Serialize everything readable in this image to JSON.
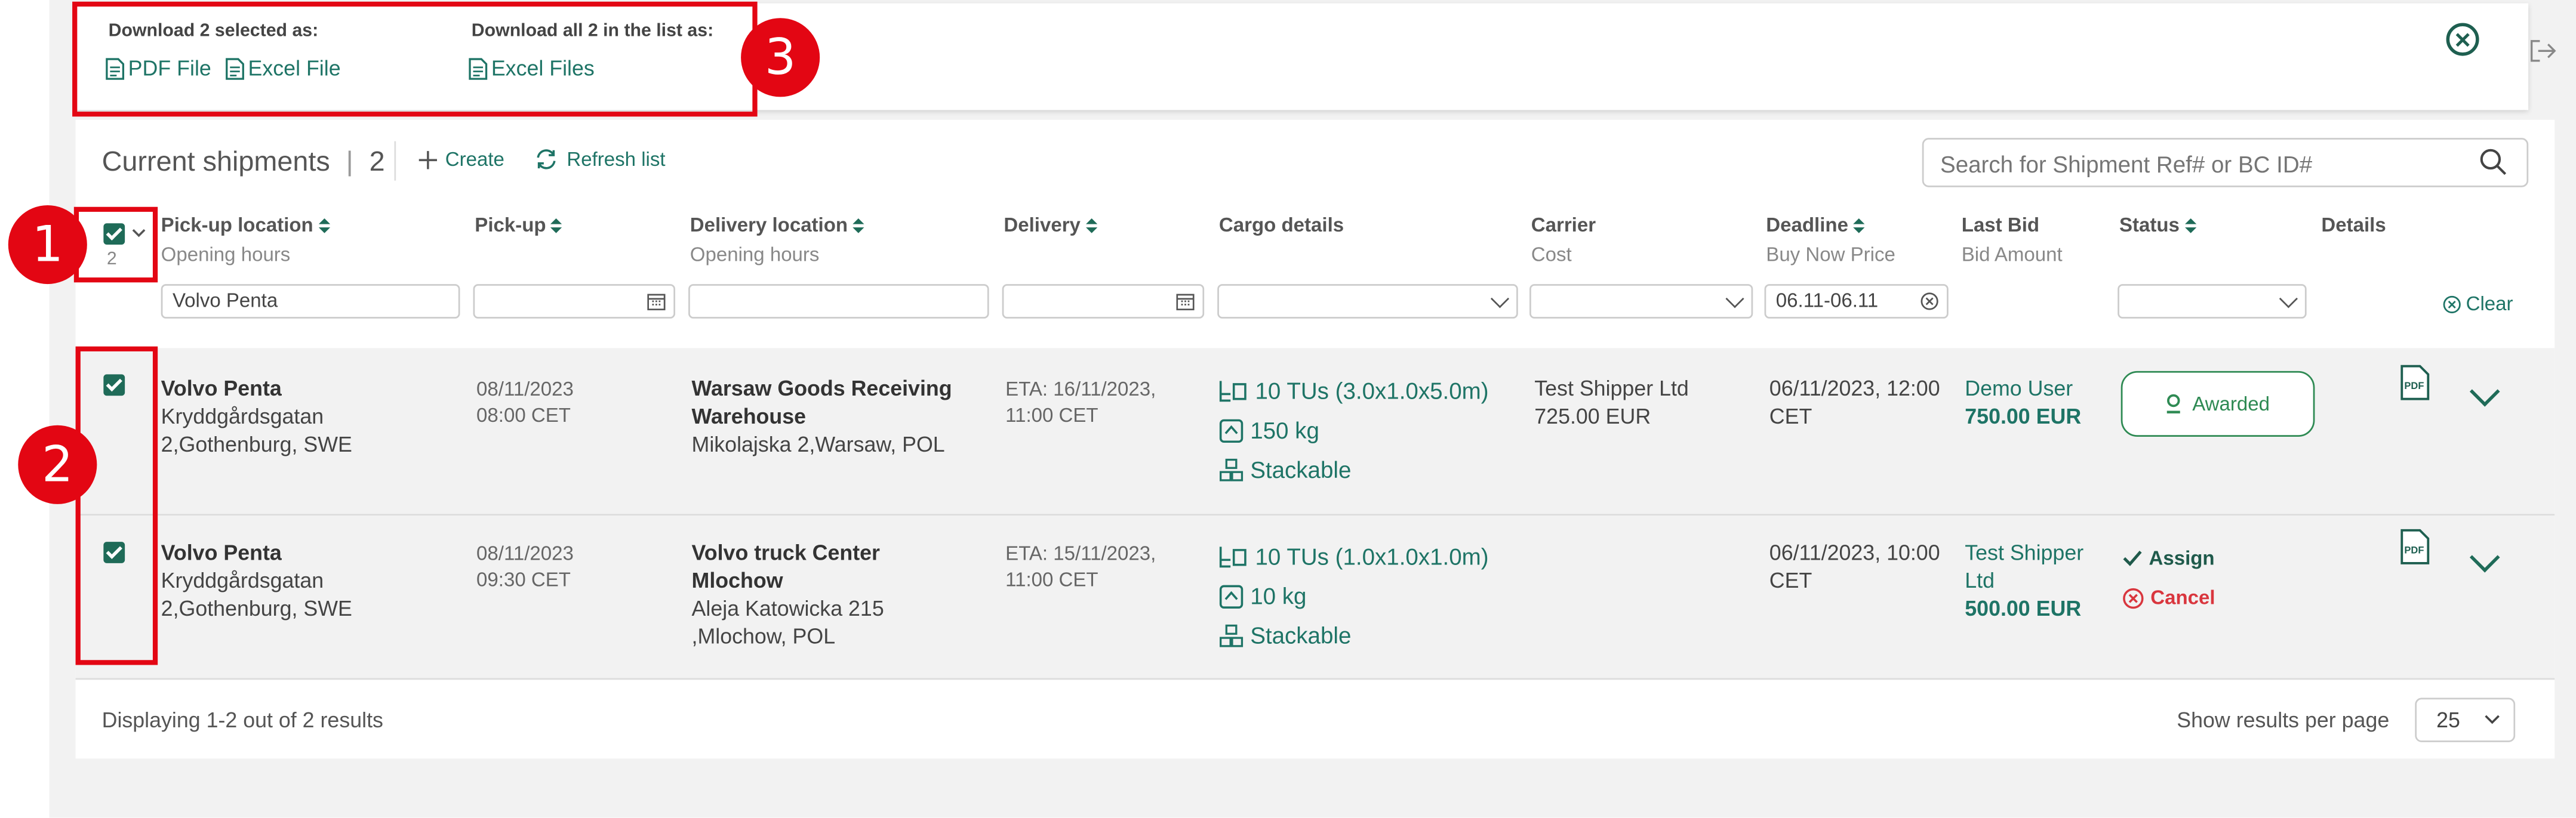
{
  "download_bar": {
    "selected_title": "Download 2 selected as:",
    "pdf_label": "PDF File",
    "excel_label": "Excel File",
    "all_title": "Download all 2 in the list as:",
    "excel_files_label": "Excel Files"
  },
  "header": {
    "title": "Current shipments",
    "count": "2",
    "create_label": "Create",
    "refresh_label": "Refresh list",
    "search_placeholder": "Search for Shipment Ref# or BC ID#"
  },
  "columns": {
    "select_count": "2",
    "pickup_location": "Pick-up location",
    "pickup_location_sub": "Opening hours",
    "pickup": "Pick-up",
    "delivery_location": "Delivery location",
    "delivery_location_sub": "Opening hours",
    "delivery": "Delivery",
    "cargo": "Cargo details",
    "carrier": "Carrier",
    "carrier_sub": "Cost",
    "deadline": "Deadline",
    "deadline_sub": "Buy Now Price",
    "last_bid": "Last Bid",
    "last_bid_sub": "Bid Amount",
    "status": "Status",
    "details": "Details"
  },
  "filters": {
    "pickup_location": "Volvo Penta",
    "deadline": "06.11-06.11",
    "clear_label": "Clear"
  },
  "rows": [
    {
      "pickup_name": "Volvo Penta",
      "pickup_addr1": "Kryddgårdsgatan",
      "pickup_addr2": "2,Gothenburg, SWE",
      "pickup_date": "08/11/2023",
      "pickup_time": "08:00 CET",
      "delivery_name1": "Warsaw Goods Receiving",
      "delivery_name2": "Warehouse",
      "delivery_addr1": "Mikolajska 2,Warsaw, POL",
      "delivery_addr2": "",
      "eta_date": "ETA:  16/11/2023,",
      "eta_time": "11:00 CET",
      "tus": "10 TUs (3.0x1.0x5.0m)",
      "weight": "150 kg",
      "stackable": "Stackable",
      "carrier": "Test Shipper Ltd",
      "cost": "725.00 EUR",
      "deadline1": "06/11/2023, 12:00",
      "deadline2": "CET",
      "bidder1": "Demo User",
      "bidder2": "",
      "bid_amount": "750.00 EUR",
      "status": "Awarded"
    },
    {
      "pickup_name": "Volvo Penta",
      "pickup_addr1": "Kryddgårdsgatan",
      "pickup_addr2": "2,Gothenburg, SWE",
      "pickup_date": "08/11/2023",
      "pickup_time": "09:30 CET",
      "delivery_name1": "Volvo truck Center",
      "delivery_name2": "Mlochow",
      "delivery_addr1": "Aleja Katowicka 215",
      "delivery_addr2": ",Mlochow, POL",
      "eta_date": "ETA:  15/11/2023,",
      "eta_time": "11:00 CET",
      "tus": "10 TUs (1.0x1.0x1.0m)",
      "weight": "10 kg",
      "stackable": "Stackable",
      "carrier": "",
      "cost": "",
      "deadline1": "06/11/2023, 10:00",
      "deadline2": "CET",
      "bidder1": "Test Shipper",
      "bidder2": "Ltd",
      "bid_amount": "500.00 EUR",
      "assign_label": "Assign",
      "cancel_label": "Cancel"
    }
  ],
  "footer": {
    "displaying": "Displaying 1-2 out of 2 results",
    "per_page_label": "Show results per page",
    "per_page_value": "25"
  },
  "annotations": {
    "badge1": "1",
    "badge2": "2",
    "badge3": "3"
  },
  "colors": {
    "accent": "#1f6b58",
    "annotation": "#e30613",
    "awarded": "#2e8a53",
    "cancel": "#d9363e"
  }
}
